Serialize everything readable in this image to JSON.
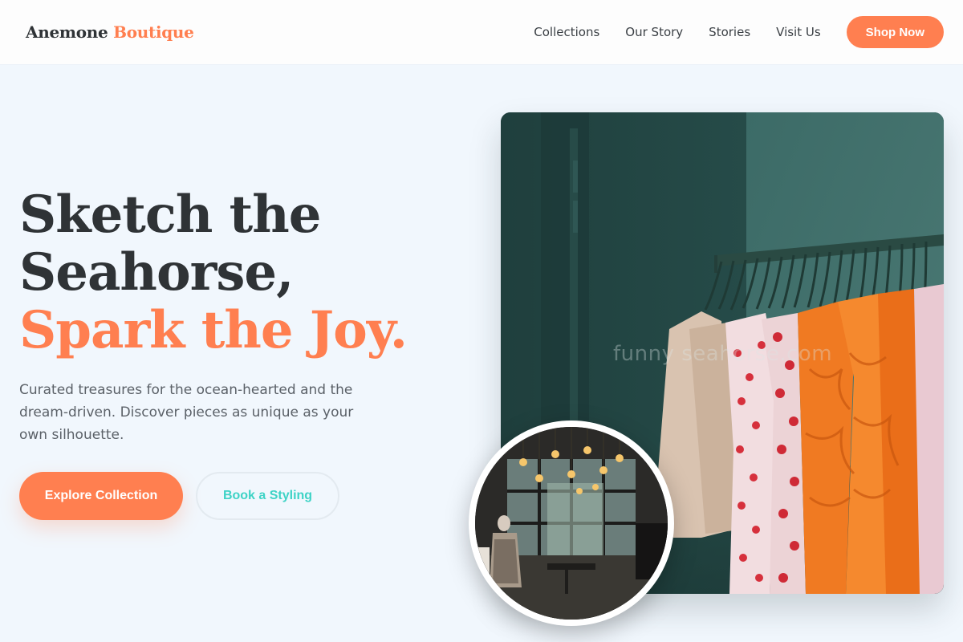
{
  "header": {
    "logo_main": "Anemone",
    "logo_accent": "Boutique",
    "nav": [
      "Collections",
      "Our Story",
      "Stories",
      "Visit Us"
    ],
    "cta": "Shop Now"
  },
  "hero": {
    "title_line1": "Sketch the",
    "title_line2": "Seahorse,",
    "title_line3": "Spark the Joy.",
    "description": "Curated treasures for the ocean-hearted and the dream-driven. Discover pieces as unique as your own silhouette.",
    "primary_button": "Explore Collection",
    "secondary_button": "Book a Styling",
    "watermark": "funny seahorse.com"
  },
  "colors": {
    "accent": "#ff7f50",
    "teal": "#3fd3c6",
    "background": "#f1f7fd",
    "text": "#2f3336"
  }
}
